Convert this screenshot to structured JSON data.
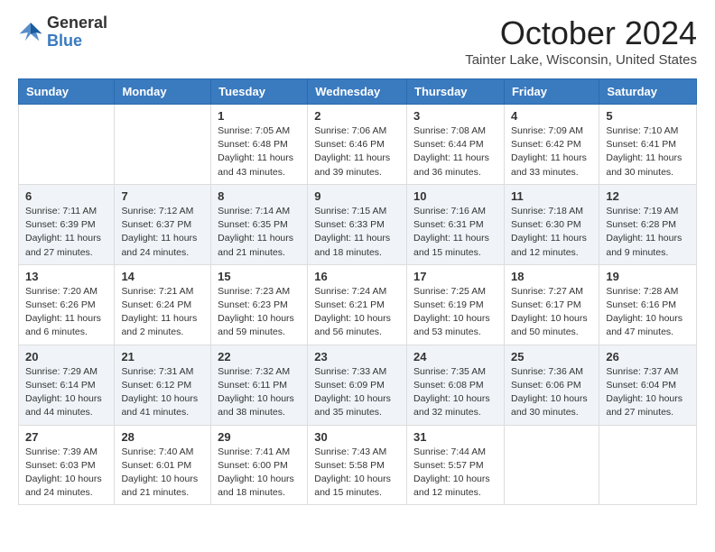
{
  "header": {
    "logo_general": "General",
    "logo_blue": "Blue",
    "month_year": "October 2024",
    "location": "Tainter Lake, Wisconsin, United States"
  },
  "weekdays": [
    "Sunday",
    "Monday",
    "Tuesday",
    "Wednesday",
    "Thursday",
    "Friday",
    "Saturday"
  ],
  "weeks": [
    [
      {
        "day": "",
        "sunrise": "",
        "sunset": "",
        "daylight": ""
      },
      {
        "day": "",
        "sunrise": "",
        "sunset": "",
        "daylight": ""
      },
      {
        "day": "1",
        "sunrise": "Sunrise: 7:05 AM",
        "sunset": "Sunset: 6:48 PM",
        "daylight": "Daylight: 11 hours and 43 minutes."
      },
      {
        "day": "2",
        "sunrise": "Sunrise: 7:06 AM",
        "sunset": "Sunset: 6:46 PM",
        "daylight": "Daylight: 11 hours and 39 minutes."
      },
      {
        "day": "3",
        "sunrise": "Sunrise: 7:08 AM",
        "sunset": "Sunset: 6:44 PM",
        "daylight": "Daylight: 11 hours and 36 minutes."
      },
      {
        "day": "4",
        "sunrise": "Sunrise: 7:09 AM",
        "sunset": "Sunset: 6:42 PM",
        "daylight": "Daylight: 11 hours and 33 minutes."
      },
      {
        "day": "5",
        "sunrise": "Sunrise: 7:10 AM",
        "sunset": "Sunset: 6:41 PM",
        "daylight": "Daylight: 11 hours and 30 minutes."
      }
    ],
    [
      {
        "day": "6",
        "sunrise": "Sunrise: 7:11 AM",
        "sunset": "Sunset: 6:39 PM",
        "daylight": "Daylight: 11 hours and 27 minutes."
      },
      {
        "day": "7",
        "sunrise": "Sunrise: 7:12 AM",
        "sunset": "Sunset: 6:37 PM",
        "daylight": "Daylight: 11 hours and 24 minutes."
      },
      {
        "day": "8",
        "sunrise": "Sunrise: 7:14 AM",
        "sunset": "Sunset: 6:35 PM",
        "daylight": "Daylight: 11 hours and 21 minutes."
      },
      {
        "day": "9",
        "sunrise": "Sunrise: 7:15 AM",
        "sunset": "Sunset: 6:33 PM",
        "daylight": "Daylight: 11 hours and 18 minutes."
      },
      {
        "day": "10",
        "sunrise": "Sunrise: 7:16 AM",
        "sunset": "Sunset: 6:31 PM",
        "daylight": "Daylight: 11 hours and 15 minutes."
      },
      {
        "day": "11",
        "sunrise": "Sunrise: 7:18 AM",
        "sunset": "Sunset: 6:30 PM",
        "daylight": "Daylight: 11 hours and 12 minutes."
      },
      {
        "day": "12",
        "sunrise": "Sunrise: 7:19 AM",
        "sunset": "Sunset: 6:28 PM",
        "daylight": "Daylight: 11 hours and 9 minutes."
      }
    ],
    [
      {
        "day": "13",
        "sunrise": "Sunrise: 7:20 AM",
        "sunset": "Sunset: 6:26 PM",
        "daylight": "Daylight: 11 hours and 6 minutes."
      },
      {
        "day": "14",
        "sunrise": "Sunrise: 7:21 AM",
        "sunset": "Sunset: 6:24 PM",
        "daylight": "Daylight: 11 hours and 2 minutes."
      },
      {
        "day": "15",
        "sunrise": "Sunrise: 7:23 AM",
        "sunset": "Sunset: 6:23 PM",
        "daylight": "Daylight: 10 hours and 59 minutes."
      },
      {
        "day": "16",
        "sunrise": "Sunrise: 7:24 AM",
        "sunset": "Sunset: 6:21 PM",
        "daylight": "Daylight: 10 hours and 56 minutes."
      },
      {
        "day": "17",
        "sunrise": "Sunrise: 7:25 AM",
        "sunset": "Sunset: 6:19 PM",
        "daylight": "Daylight: 10 hours and 53 minutes."
      },
      {
        "day": "18",
        "sunrise": "Sunrise: 7:27 AM",
        "sunset": "Sunset: 6:17 PM",
        "daylight": "Daylight: 10 hours and 50 minutes."
      },
      {
        "day": "19",
        "sunrise": "Sunrise: 7:28 AM",
        "sunset": "Sunset: 6:16 PM",
        "daylight": "Daylight: 10 hours and 47 minutes."
      }
    ],
    [
      {
        "day": "20",
        "sunrise": "Sunrise: 7:29 AM",
        "sunset": "Sunset: 6:14 PM",
        "daylight": "Daylight: 10 hours and 44 minutes."
      },
      {
        "day": "21",
        "sunrise": "Sunrise: 7:31 AM",
        "sunset": "Sunset: 6:12 PM",
        "daylight": "Daylight: 10 hours and 41 minutes."
      },
      {
        "day": "22",
        "sunrise": "Sunrise: 7:32 AM",
        "sunset": "Sunset: 6:11 PM",
        "daylight": "Daylight: 10 hours and 38 minutes."
      },
      {
        "day": "23",
        "sunrise": "Sunrise: 7:33 AM",
        "sunset": "Sunset: 6:09 PM",
        "daylight": "Daylight: 10 hours and 35 minutes."
      },
      {
        "day": "24",
        "sunrise": "Sunrise: 7:35 AM",
        "sunset": "Sunset: 6:08 PM",
        "daylight": "Daylight: 10 hours and 32 minutes."
      },
      {
        "day": "25",
        "sunrise": "Sunrise: 7:36 AM",
        "sunset": "Sunset: 6:06 PM",
        "daylight": "Daylight: 10 hours and 30 minutes."
      },
      {
        "day": "26",
        "sunrise": "Sunrise: 7:37 AM",
        "sunset": "Sunset: 6:04 PM",
        "daylight": "Daylight: 10 hours and 27 minutes."
      }
    ],
    [
      {
        "day": "27",
        "sunrise": "Sunrise: 7:39 AM",
        "sunset": "Sunset: 6:03 PM",
        "daylight": "Daylight: 10 hours and 24 minutes."
      },
      {
        "day": "28",
        "sunrise": "Sunrise: 7:40 AM",
        "sunset": "Sunset: 6:01 PM",
        "daylight": "Daylight: 10 hours and 21 minutes."
      },
      {
        "day": "29",
        "sunrise": "Sunrise: 7:41 AM",
        "sunset": "Sunset: 6:00 PM",
        "daylight": "Daylight: 10 hours and 18 minutes."
      },
      {
        "day": "30",
        "sunrise": "Sunrise: 7:43 AM",
        "sunset": "Sunset: 5:58 PM",
        "daylight": "Daylight: 10 hours and 15 minutes."
      },
      {
        "day": "31",
        "sunrise": "Sunrise: 7:44 AM",
        "sunset": "Sunset: 5:57 PM",
        "daylight": "Daylight: 10 hours and 12 minutes."
      },
      {
        "day": "",
        "sunrise": "",
        "sunset": "",
        "daylight": ""
      },
      {
        "day": "",
        "sunrise": "",
        "sunset": "",
        "daylight": ""
      }
    ]
  ]
}
